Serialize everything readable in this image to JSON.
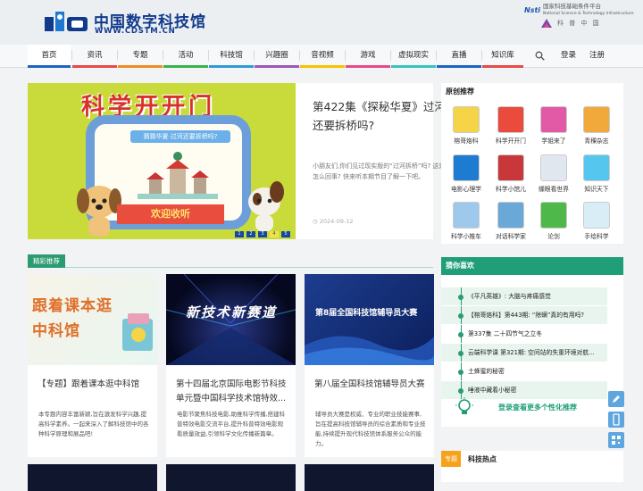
{
  "header": {
    "logo_cn": "中国数字科技馆",
    "logo_url": "WWW.CDSTM.CN",
    "partner1_badge": "Nsti",
    "partner1_text_cn": "国家科技基础条件平台",
    "partner1_text_en": "National Science & Technology Infrastructure",
    "partner2_text": "科 普 中 国"
  },
  "nav": {
    "items": [
      {
        "label": "首页",
        "bar": "#1b64c4"
      },
      {
        "label": "资讯",
        "bar": "#e84a4a"
      },
      {
        "label": "专题",
        "bar": "#f08a24"
      },
      {
        "label": "活动",
        "bar": "#3bb34a"
      },
      {
        "label": "科技馆",
        "bar": "#2e9bd6"
      },
      {
        "label": "兴趣圈",
        "bar": "#9b59b6"
      },
      {
        "label": "音视频",
        "bar": "#f5c400"
      },
      {
        "label": "游戏",
        "bar": "#e84a8a"
      },
      {
        "label": "虚拟现实",
        "bar": "#3ac1c1"
      },
      {
        "label": "直播",
        "bar": "#1b64c4"
      },
      {
        "label": "知识库",
        "bar": "#e84a4a"
      }
    ],
    "search_icon": "search-icon",
    "login": "登录",
    "register": "注册"
  },
  "feature": {
    "image_title": "科学开开门",
    "image_caption": "猜猜华夏·过河还要拆桥吗?",
    "image_banner": "欢迎收听",
    "pages": [
      "1",
      "2",
      "3",
      "4",
      "5"
    ],
    "active_page": 4,
    "title": "第422集《探秘华夏》过河还要拆桥吗?",
    "desc": "小朋友们,你们见过现实版的“过河拆桥”吗? 这是怎么回事? 快来听本期节目了解一下吧。",
    "date": "2024-09-12"
  },
  "section": {
    "tag": "精彩推荐"
  },
  "cards": [
    {
      "img_text": "跟着课本逛中科馆",
      "title": "【专题】跟着课本逛中科馆",
      "desc": "本专题内容丰富新颖,旨在激发科学兴趣,提高科学素养。一起来深入了解科技馆中的各种科学原理和展品吧!"
    },
    {
      "img_text": "新技术新赛道",
      "title": "第十四届北京国际电影节科技单元暨中国科学技术馆特效...",
      "desc": "电影节聚焦科技电影,助推科学传播,搭建科普特效电影交流平台,提升科普特效电影观看质量效益,引领科学文化传播新篇章。"
    },
    {
      "img_text": "第8届全国科技馆辅导员大赛",
      "title": "第八届全国科技馆辅导员大赛",
      "desc": "辅导员大赛是权威、专业的职业技能赛事,旨在提高科技馆辅导员的综合素质和专业技能,持续提升现代科技馆体系服务公众的能力。"
    }
  ],
  "side": {
    "original_head": "原创推荐",
    "apps": [
      {
        "label": "榕哥烙科",
        "color": "#f5d547"
      },
      {
        "label": "科学开开门",
        "color": "#ea4b3c"
      },
      {
        "label": "学姐来了",
        "color": "#e25aa5"
      },
      {
        "label": "青稞杂志",
        "color": "#f2a93b"
      },
      {
        "label": "电影心理学",
        "color": "#1d7bd1"
      },
      {
        "label": "科学小馆儿",
        "color": "#c8383b"
      },
      {
        "label": "蝶眼看世界",
        "color": "#e0e7ef"
      },
      {
        "label": "知识天下",
        "color": "#55c7ef"
      },
      {
        "label": "科学小推车",
        "color": "#9ec8ec"
      },
      {
        "label": "对话科学家",
        "color": "#6aa8d8"
      },
      {
        "label": "论剑",
        "color": "#4fb84b"
      },
      {
        "label": "手绘科学",
        "color": "#d9edf7"
      }
    ],
    "guess_head": "猜你喜欢",
    "recommendations": [
      "《平凡英雄》: 大脑与疼痛感觉",
      "【榕哥烙科】第443期: “除螨”真的有用吗?",
      "第337集 二十四节气之立冬",
      "云端科学课 第321期: 空间站的失重环境对航...",
      "土蜂蜜的秘密",
      "唾液中藏着小秘密"
    ],
    "cta": "登录查看更多个性化推荐",
    "hot_tag": "专题",
    "hot_head": "科技热点"
  }
}
